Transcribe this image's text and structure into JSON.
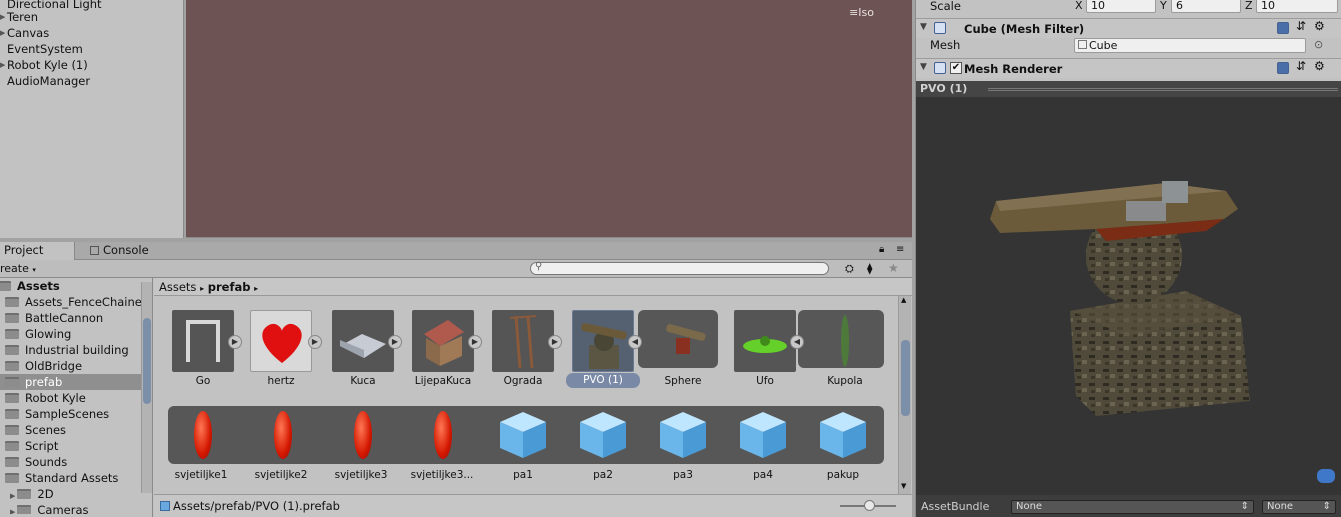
{
  "hierarchy": {
    "items": [
      {
        "label": "Directional Light",
        "expandable": false
      },
      {
        "label": "Teren",
        "expandable": true
      },
      {
        "label": "Canvas",
        "expandable": true
      },
      {
        "label": "EventSystem",
        "expandable": false
      },
      {
        "label": "Robot Kyle (1)",
        "expandable": true
      },
      {
        "label": "AudioManager",
        "expandable": false
      }
    ]
  },
  "scene": {
    "projection_label": "Iso"
  },
  "inspector": {
    "scale": {
      "label": "Scale",
      "x_label": "X",
      "x": "10",
      "y_label": "Y",
      "y": "6",
      "z_label": "Z",
      "z": "10"
    },
    "mesh_filter": {
      "title": "Cube (Mesh Filter)",
      "mesh_label": "Mesh",
      "mesh_value": "Cube"
    },
    "mesh_renderer": {
      "title": "Mesh Renderer",
      "enabled": true
    }
  },
  "preview": {
    "title": "PVO (1)",
    "asset_bundle_label": "AssetBundle",
    "bundle_value": "None",
    "variant_value": "None"
  },
  "project": {
    "tabs": [
      {
        "label": "Project",
        "active": true
      },
      {
        "label": "Console",
        "active": false
      }
    ],
    "create_label": "reate",
    "tree": [
      {
        "label": "Assets",
        "bold": true,
        "level": 0
      },
      {
        "label": "Assets_FenceChained",
        "level": 1
      },
      {
        "label": "BattleCannon",
        "level": 1
      },
      {
        "label": "Glowing",
        "level": 1
      },
      {
        "label": "Industrial building",
        "level": 1
      },
      {
        "label": "OldBridge",
        "level": 1
      },
      {
        "label": "prefab",
        "level": 1,
        "selected": true
      },
      {
        "label": "Robot Kyle",
        "level": 1
      },
      {
        "label": "SampleScenes",
        "level": 1
      },
      {
        "label": "Scenes",
        "level": 1
      },
      {
        "label": "Script",
        "level": 1
      },
      {
        "label": "Sounds",
        "level": 1
      },
      {
        "label": "Standard Assets",
        "level": 1
      },
      {
        "label": "2D",
        "level": 2
      },
      {
        "label": "Cameras",
        "level": 2
      }
    ],
    "breadcrumb": [
      "Assets",
      "prefab"
    ],
    "row1": [
      "Go",
      "hertz",
      "Kuca",
      "LijepaKuca",
      "Ograda",
      "PVO (1)",
      "Sphere",
      "Ufo",
      "Kupola"
    ],
    "row2": [
      "svjetiljke1",
      "svjetiljke2",
      "svjetiljke3",
      "svjetiljke3...",
      "pa1",
      "pa2",
      "pa3",
      "pa4",
      "pakup"
    ],
    "selected_asset": "PVO (1)",
    "status_path": "Assets/prefab/PVO (1).prefab"
  }
}
